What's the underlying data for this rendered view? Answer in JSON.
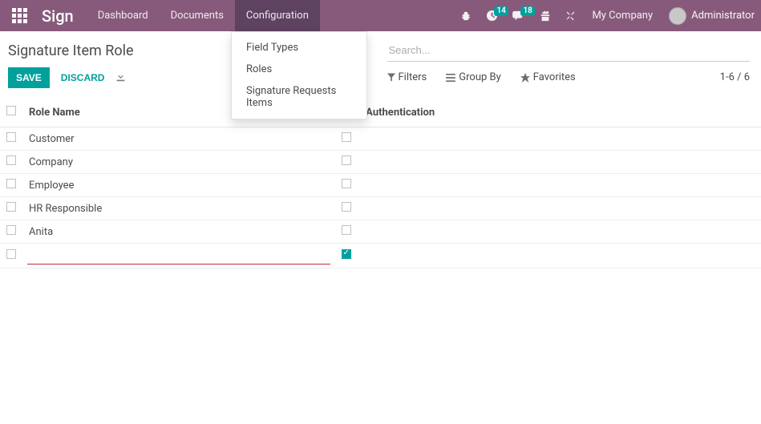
{
  "navbar": {
    "brand": "Sign",
    "menu": [
      "Dashboard",
      "Documents",
      "Configuration"
    ],
    "active_menu": 2,
    "badge_activities": "14",
    "badge_discuss": "18",
    "company": "My Company",
    "user": "Administrator"
  },
  "dropdown": {
    "items": [
      "Field Types",
      "Roles",
      "Signature Requests Items"
    ]
  },
  "ctrl": {
    "breadcrumb": "Signature Item Role",
    "save": "SAVE",
    "discard": "DISCARD",
    "search_placeholder": "Search...",
    "filters": "Filters",
    "group_by": "Group By",
    "favorites": "Favorites",
    "pager": "1-6 / 6"
  },
  "table": {
    "col_role": "Role Name",
    "col_sms": "SMS Authentication",
    "rows": [
      {
        "name": "Customer",
        "sms": false
      },
      {
        "name": "Company",
        "sms": false
      },
      {
        "name": "Employee",
        "sms": false
      },
      {
        "name": "HR Responsible",
        "sms": false
      },
      {
        "name": "Anita",
        "sms": false
      }
    ],
    "editing_row": {
      "name": "",
      "sms": true
    }
  }
}
